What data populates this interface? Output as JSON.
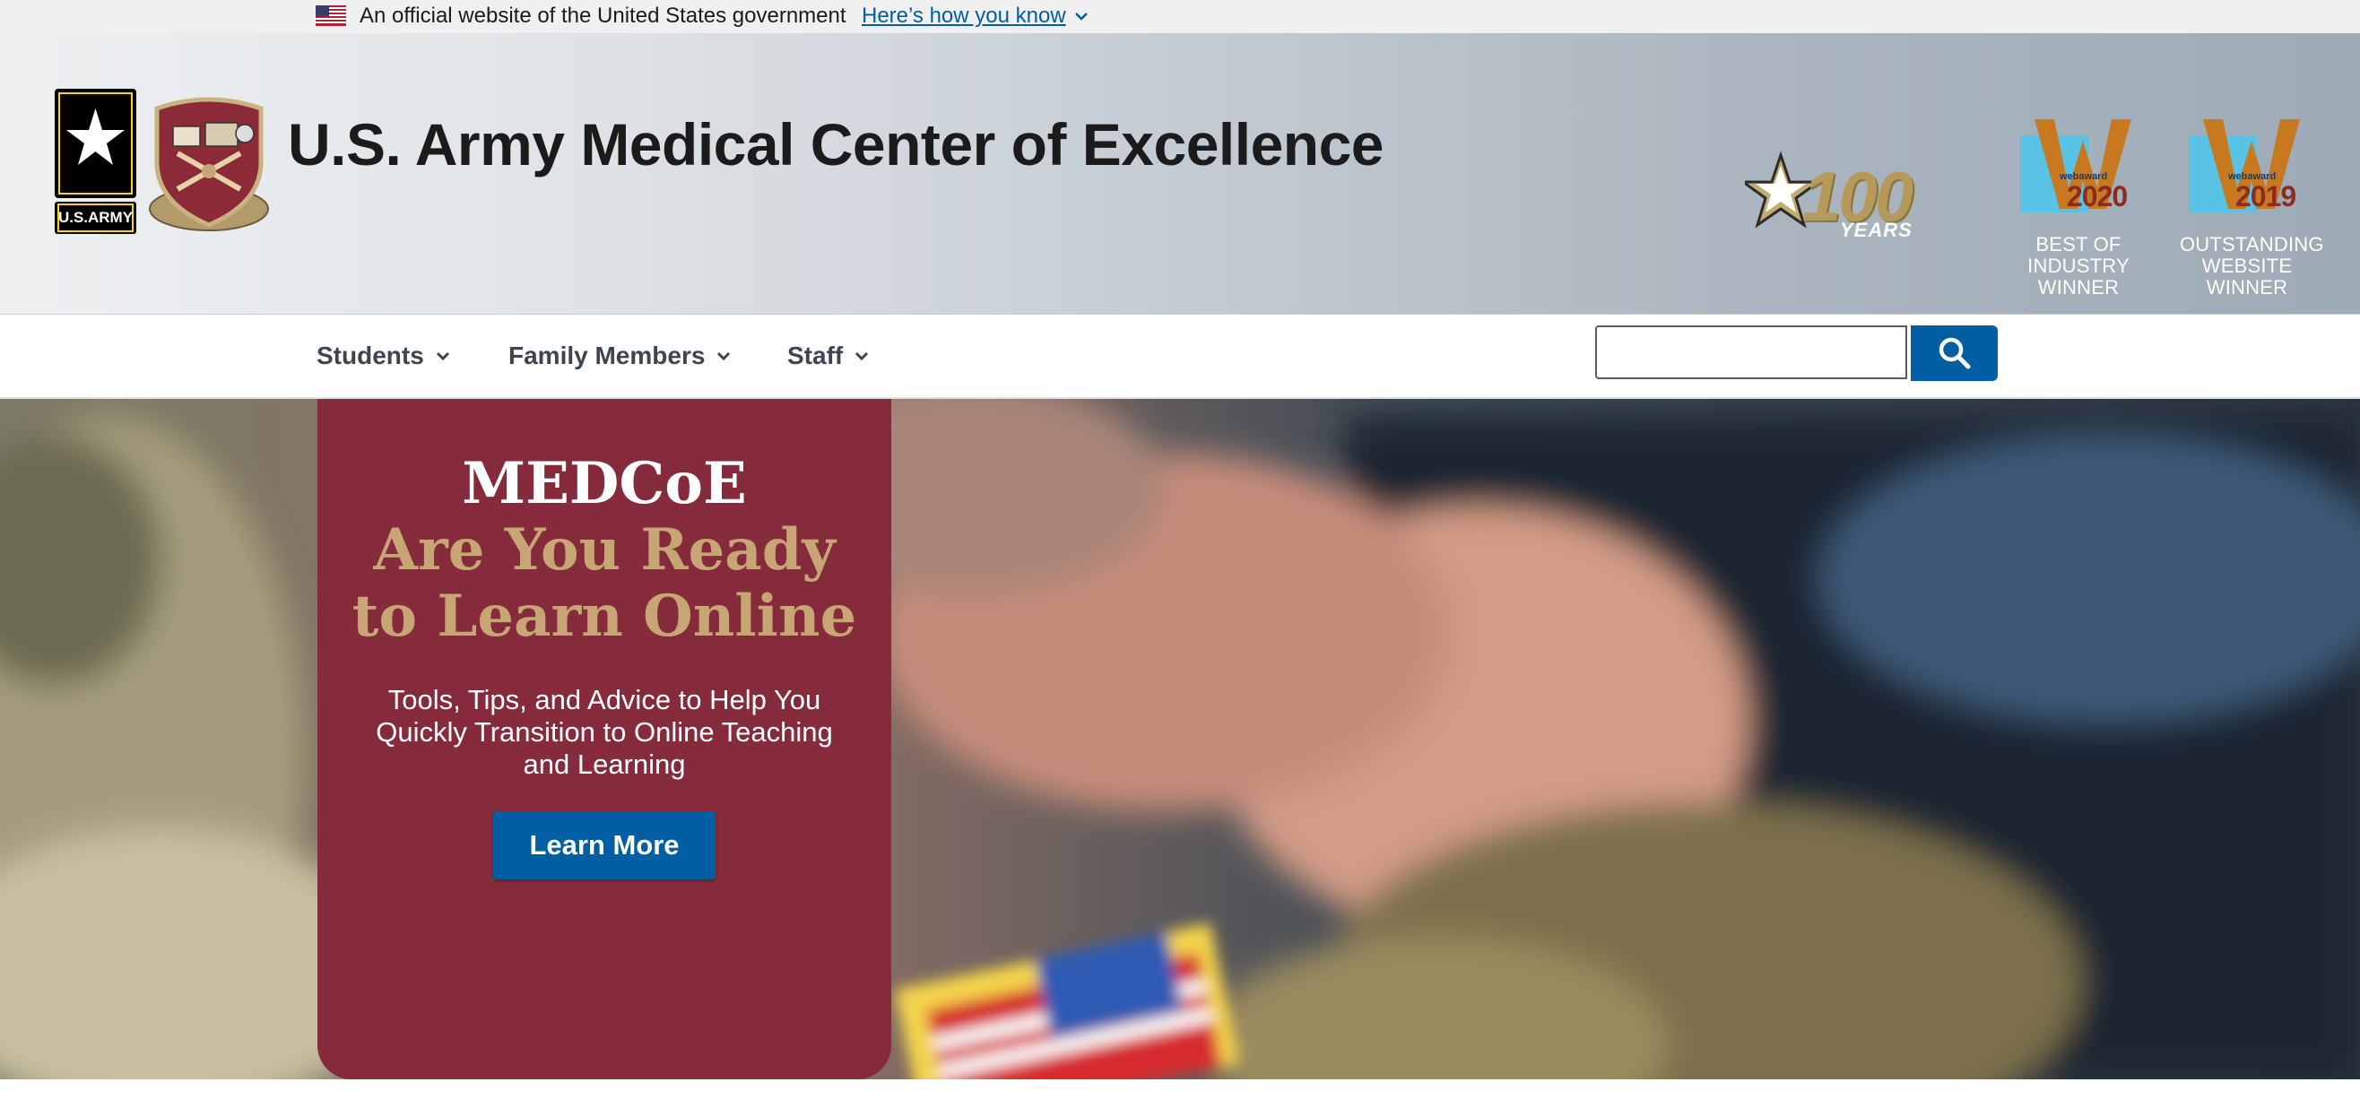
{
  "gov_banner": {
    "text": "An official website of the United States government",
    "link_label": "Here’s how you know"
  },
  "header": {
    "army_logo_text": "U.S.ARMY",
    "title": "U.S. Army Medical Center of Excellence",
    "centennial": {
      "number": "100",
      "label": "YEARS"
    },
    "awards": [
      {
        "brand": "webaward",
        "year": "2020",
        "caption": "BEST OF INDUSTRY WINNER"
      },
      {
        "brand": "webaward",
        "year": "2019",
        "caption": "OUTSTANDING WEBSITE WINNER"
      }
    ]
  },
  "nav": {
    "items": [
      {
        "label": "Students"
      },
      {
        "label": "Family Members"
      },
      {
        "label": "Staff"
      }
    ],
    "search": {
      "value": "",
      "button_icon": "search-icon"
    }
  },
  "hero": {
    "title_line1": "MEDCoE",
    "title_line2": "Are You Ready",
    "title_line3": "to Learn Online",
    "subtitle": "Tools, Tips, and Advice to Help You Quickly Transition to Online Teaching and Learning",
    "button_label": "Learn More"
  },
  "colors": {
    "gov_link": "#005ea2",
    "card_maroon": "#852b3b",
    "title_gold": "#c7a574",
    "button_blue": "#005ea2"
  }
}
